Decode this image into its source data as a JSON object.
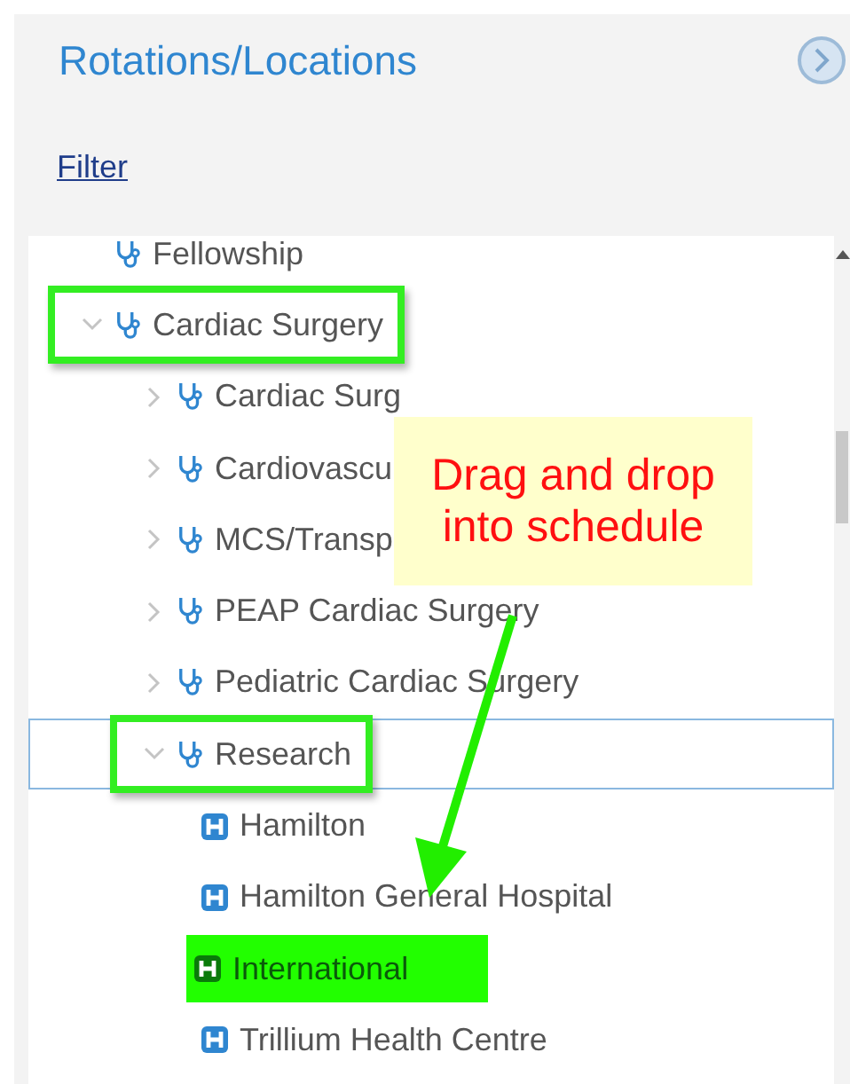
{
  "panel": {
    "title": "Rotations/Locations",
    "filter_link": "Filter"
  },
  "tree": [
    {
      "label": "Fellowship",
      "kind": "specialty",
      "highlighted": false,
      "selected": false
    },
    {
      "label": "Cardiac Surgery",
      "kind": "specialty",
      "expanded": true,
      "highlighted": true,
      "selected": false,
      "children": [
        {
          "label": "Cardiac Surg",
          "kind": "specialty",
          "expanded": false,
          "highlighted": false,
          "selected": false
        },
        {
          "label": "Cardiovascu",
          "kind": "specialty",
          "expanded": false,
          "highlighted": false,
          "selected": false
        },
        {
          "label": "MCS/Transp",
          "kind": "specialty",
          "expanded": false,
          "highlighted": false,
          "selected": false
        },
        {
          "label": "PEAP Cardiac Surgery",
          "kind": "specialty",
          "expanded": false,
          "highlighted": false,
          "selected": false
        },
        {
          "label": "Pediatric Cardiac Surgery",
          "kind": "specialty",
          "expanded": false,
          "highlighted": false,
          "selected": false
        },
        {
          "label": "Research",
          "kind": "specialty",
          "expanded": true,
          "highlighted": true,
          "selected": true,
          "children": [
            {
              "label": "Hamilton",
              "kind": "location",
              "highlighted": false,
              "selected": false
            },
            {
              "label": "Hamilton General Hospital",
              "kind": "location",
              "highlighted": false,
              "selected": false
            },
            {
              "label": "International",
              "kind": "location",
              "highlighted": true,
              "selected": false
            },
            {
              "label": "Trillium Health Centre",
              "kind": "location",
              "highlighted": false,
              "selected": false
            }
          ]
        }
      ]
    }
  ],
  "callout": {
    "text": "Drag and drop into schedule"
  }
}
